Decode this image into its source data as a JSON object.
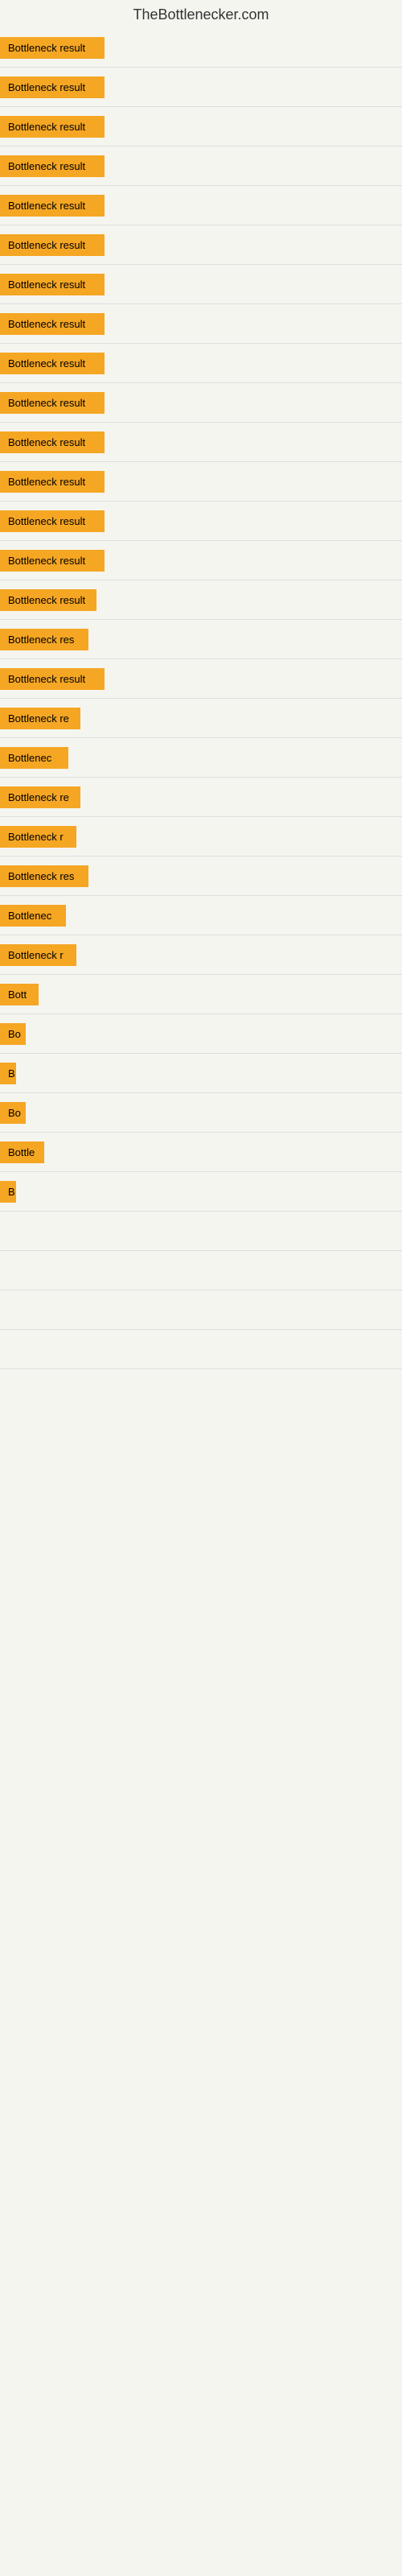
{
  "site": {
    "title": "TheBottlenecker.com"
  },
  "items": [
    {
      "label": "Bottleneck result",
      "width": 130,
      "visible": true
    },
    {
      "label": "Bottleneck result",
      "width": 130,
      "visible": true
    },
    {
      "label": "Bottleneck result",
      "width": 130,
      "visible": true
    },
    {
      "label": "Bottleneck result",
      "width": 130,
      "visible": true
    },
    {
      "label": "Bottleneck result",
      "width": 130,
      "visible": true
    },
    {
      "label": "Bottleneck result",
      "width": 130,
      "visible": true
    },
    {
      "label": "Bottleneck result",
      "width": 130,
      "visible": true
    },
    {
      "label": "Bottleneck result",
      "width": 130,
      "visible": true
    },
    {
      "label": "Bottleneck result",
      "width": 130,
      "visible": true
    },
    {
      "label": "Bottleneck result",
      "width": 130,
      "visible": true
    },
    {
      "label": "Bottleneck result",
      "width": 130,
      "visible": true
    },
    {
      "label": "Bottleneck result",
      "width": 130,
      "visible": true
    },
    {
      "label": "Bottleneck result",
      "width": 130,
      "visible": true
    },
    {
      "label": "Bottleneck result",
      "width": 130,
      "visible": true
    },
    {
      "label": "Bottleneck result",
      "width": 120,
      "visible": true
    },
    {
      "label": "Bottleneck res",
      "width": 110,
      "visible": true
    },
    {
      "label": "Bottleneck result",
      "width": 130,
      "visible": true
    },
    {
      "label": "Bottleneck re",
      "width": 100,
      "visible": true
    },
    {
      "label": "Bottlenec",
      "width": 85,
      "visible": true
    },
    {
      "label": "Bottleneck re",
      "width": 100,
      "visible": true
    },
    {
      "label": "Bottleneck r",
      "width": 95,
      "visible": true
    },
    {
      "label": "Bottleneck res",
      "width": 110,
      "visible": true
    },
    {
      "label": "Bottlenec",
      "width": 82,
      "visible": true
    },
    {
      "label": "Bottleneck r",
      "width": 95,
      "visible": true
    },
    {
      "label": "Bott",
      "width": 48,
      "visible": true
    },
    {
      "label": "Bo",
      "width": 32,
      "visible": true
    },
    {
      "label": "B",
      "width": 16,
      "visible": true
    },
    {
      "label": "Bo",
      "width": 32,
      "visible": true
    },
    {
      "label": "Bottle",
      "width": 55,
      "visible": true
    },
    {
      "label": "B",
      "width": 14,
      "visible": true
    },
    {
      "label": "",
      "width": 0,
      "visible": false
    },
    {
      "label": "",
      "width": 0,
      "visible": false
    },
    {
      "label": "",
      "width": 0,
      "visible": false
    },
    {
      "label": "",
      "width": 0,
      "visible": false
    },
    {
      "label": "",
      "width": 0,
      "visible": false
    }
  ]
}
